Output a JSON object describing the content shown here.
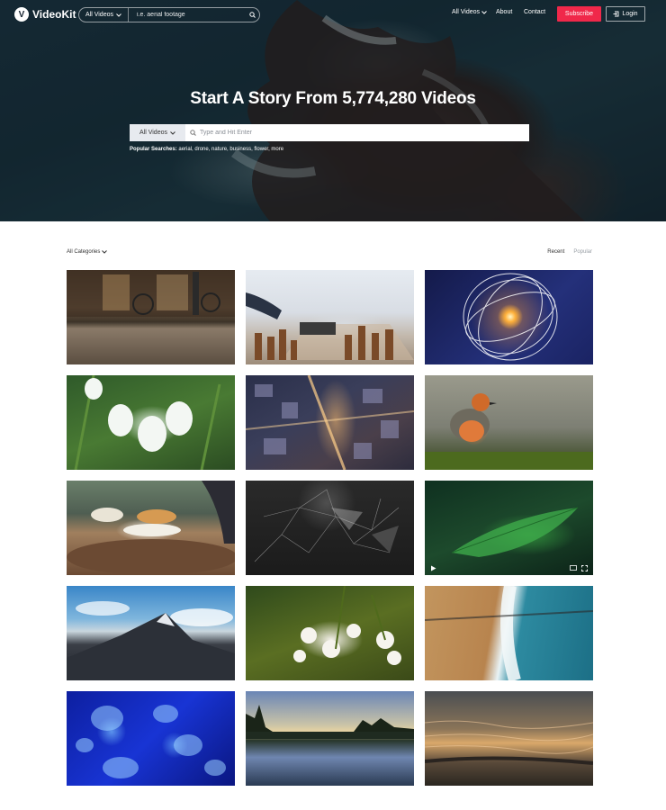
{
  "brand": {
    "logo_letter": "V",
    "name": "VideoKit"
  },
  "nav": {
    "search_filter": "All Videos",
    "search_placeholder": "i.e. aerial footage",
    "links": [
      "All Videos",
      "About",
      "Contact"
    ],
    "subscribe_label": "Subscribe",
    "login_label": "Login"
  },
  "hero": {
    "title": "Start A Story From 5,774,280 Videos",
    "search_filter": "All Videos",
    "search_placeholder": "Type and Hit Enter",
    "popular_label": "Popular Searches:",
    "popular_terms": "aerial, drone, nature, business, flower, more"
  },
  "listing": {
    "category_filter": "All Categories",
    "sort_options": [
      "Recent",
      "Popular"
    ],
    "active_sort": "Recent"
  },
  "videos": [
    {
      "name": "street-bicycles"
    },
    {
      "name": "chess-game"
    },
    {
      "name": "glowing-sphere"
    },
    {
      "name": "snowdrop-flowers"
    },
    {
      "name": "city-night-aerial"
    },
    {
      "name": "robin-bird"
    },
    {
      "name": "dinner-table"
    },
    {
      "name": "network-mesh"
    },
    {
      "name": "green-leaf"
    },
    {
      "name": "mountain-peak"
    },
    {
      "name": "white-blossoms"
    },
    {
      "name": "beach-aerial"
    },
    {
      "name": "blue-jellyfish"
    },
    {
      "name": "lake-sunset"
    },
    {
      "name": "ocean-waves"
    }
  ],
  "colors": {
    "accent": "#f0284a",
    "hero_overlay": "#0c141c"
  },
  "icons": [
    "search-icon",
    "chevron-down-icon",
    "login-icon",
    "play-icon",
    "fullscreen-icon",
    "cast-icon"
  ]
}
